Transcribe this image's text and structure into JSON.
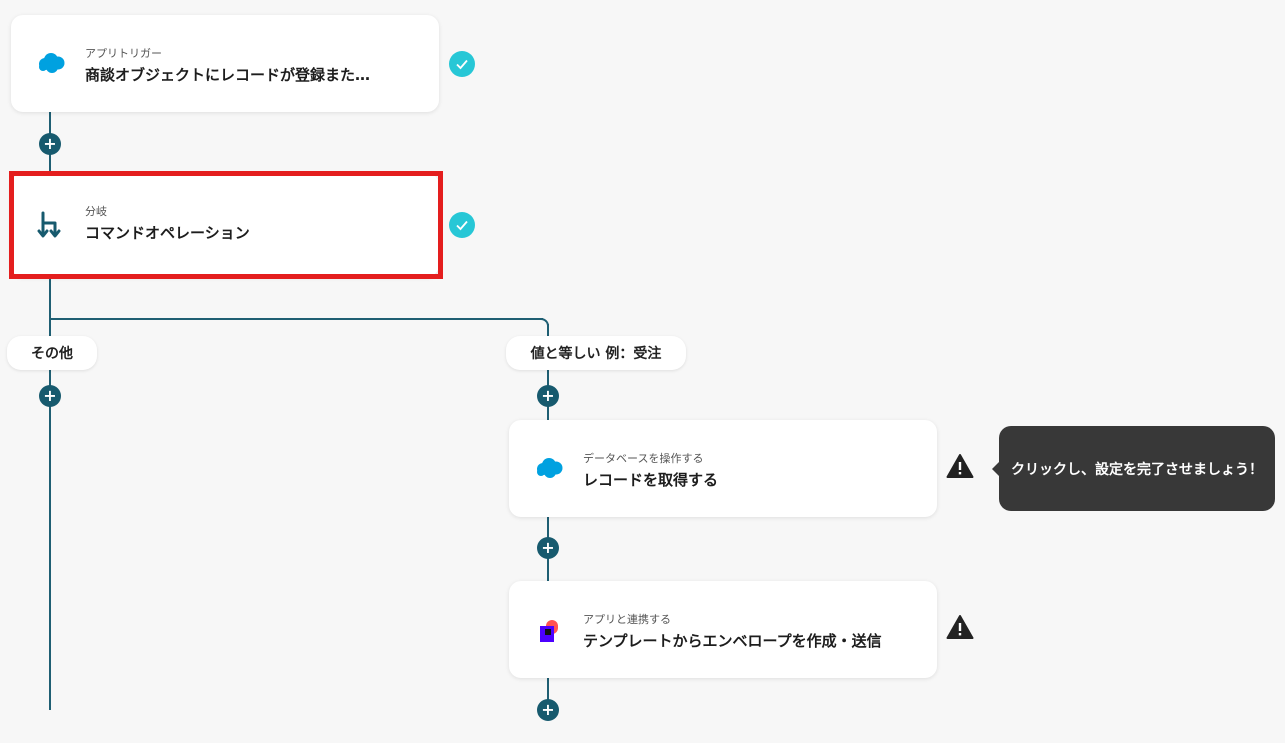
{
  "trigger": {
    "category": "アプリトリガー",
    "title": "商談オブジェクトにレコードが登録また…",
    "icon": "salesforce-cloud-icon"
  },
  "branch": {
    "category": "分岐",
    "title": "コマンドオペレーション",
    "icon": "branch-icon"
  },
  "branches": {
    "other_label": "その他",
    "equal_label": "値と等しい 例：受注"
  },
  "step_get_record": {
    "category": "データベースを操作する",
    "title": "レコードを取得する",
    "icon": "salesforce-cloud-icon"
  },
  "step_envelope": {
    "category": "アプリと連携する",
    "title": "テンプレートからエンベロープを作成・送信",
    "icon": "docusign-icon"
  },
  "tooltip": {
    "text": "クリックし、設定を完了させましょう！"
  },
  "plus_symbol": "+",
  "colors": {
    "line": "#1f5f73",
    "check": "#27c7d6",
    "highlight": "#e41e1e",
    "salesforce": "#00a1e0"
  }
}
